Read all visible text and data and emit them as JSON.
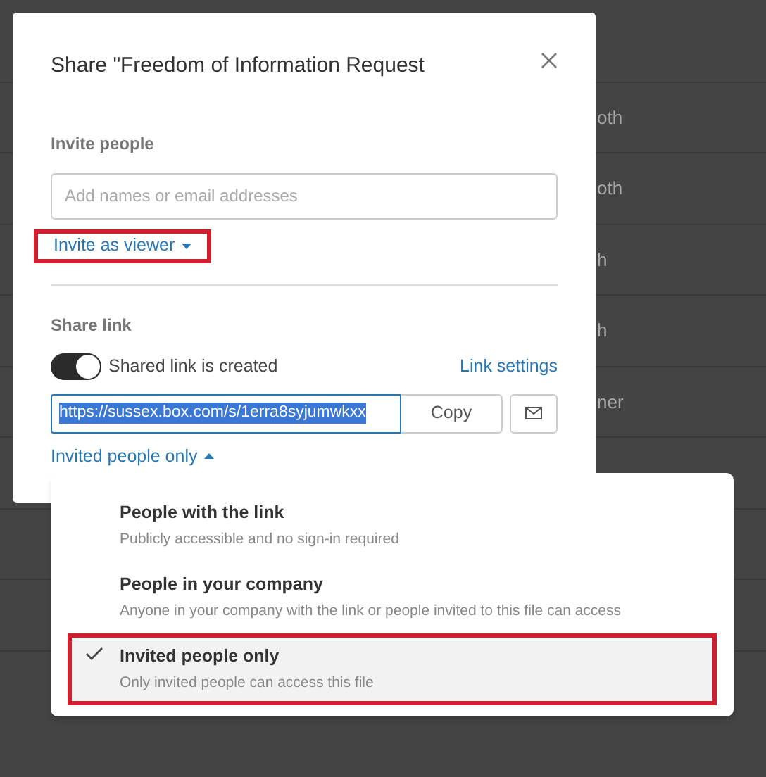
{
  "background_rows": [
    {
      "column_1": ""
    },
    {
      "column_1": "oth"
    },
    {
      "column_1": "oth"
    },
    {
      "column_1": "h"
    },
    {
      "column_1": "h"
    },
    {
      "column_1": "ner"
    },
    {
      "column_1": ""
    },
    {
      "column_1": ""
    },
    {
      "column_1": ""
    }
  ],
  "dialog": {
    "title": "Share \"Freedom of Information Request",
    "invite": {
      "label": "Invite people",
      "placeholder": "Add names or email addresses",
      "role_link": {
        "label": "Invite as viewer",
        "outlined": true
      }
    },
    "share_link": {
      "label": "Share link",
      "toggle": {
        "on": true,
        "label": "Shared link is created"
      },
      "settings_link": "Link settings",
      "url": "https://sussex.box.com/s/1erra8syjumwkxx",
      "copy_button": "Copy",
      "access_link": {
        "label": "Invited people only",
        "expanded": true
      }
    }
  },
  "access_menu": [
    {
      "title": "People with the link",
      "description": "Publicly accessible and no sign-in required",
      "selected": false,
      "outlined": false
    },
    {
      "title": "People in your company",
      "description": "Anyone in your company with the link or people invited to this file can access",
      "selected": false,
      "outlined": false
    },
    {
      "title": "Invited people only",
      "description": "Only invited people can access this file",
      "selected": true,
      "outlined": true
    }
  ]
}
